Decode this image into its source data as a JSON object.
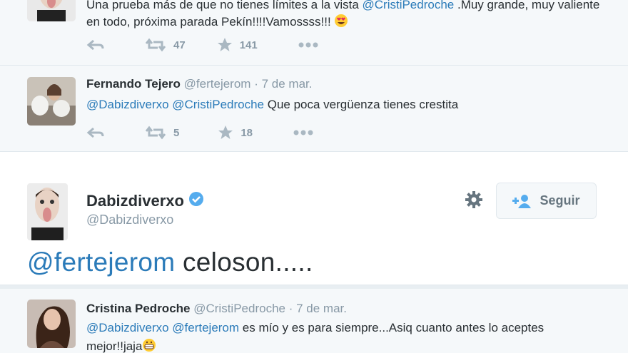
{
  "tweets": [
    {
      "text_part1": "Una prueba más de que no tienes límites a la vista ",
      "mention": "@CristiPedroche",
      "text_part2": " .Muy grande, muy valiente en todo, próxima parada Pekín!!!!Vamossss!!! ",
      "emoji": "heart-eyes-emoji",
      "retweets": "47",
      "favorites": "141"
    },
    {
      "name": "Fernando Tejero",
      "handle": "@fertejerom",
      "dot": "·",
      "time": "7 de mar.",
      "mention1": "@Dabizdiverxo",
      "mention2": "@CristiPedroche",
      "text": " Que poca vergüenza tienes crestita",
      "retweets": "5",
      "favorites": "18"
    }
  ],
  "main_tweet": {
    "name": "Dabizdiverxo",
    "handle": "@Dabizdiverxo",
    "follow_label": "Seguir",
    "mention": "@fertejerom",
    "text": " celoson....."
  },
  "reply": {
    "name": "Cristina Pedroche",
    "handle": "@CristiPedroche",
    "dot": "·",
    "time": "7 de mar.",
    "mention1": "@Dabizdiverxo",
    "mention2": "@fertejerom",
    "text": " es mío y es para siempre...Asiq cuanto antes lo aceptes mejor!!jaja",
    "emoji": "grinning-emoji"
  },
  "colors": {
    "link": "#2b7bb9",
    "verified": "#55acee",
    "muted": "#8899a6",
    "text": "#292f33"
  }
}
